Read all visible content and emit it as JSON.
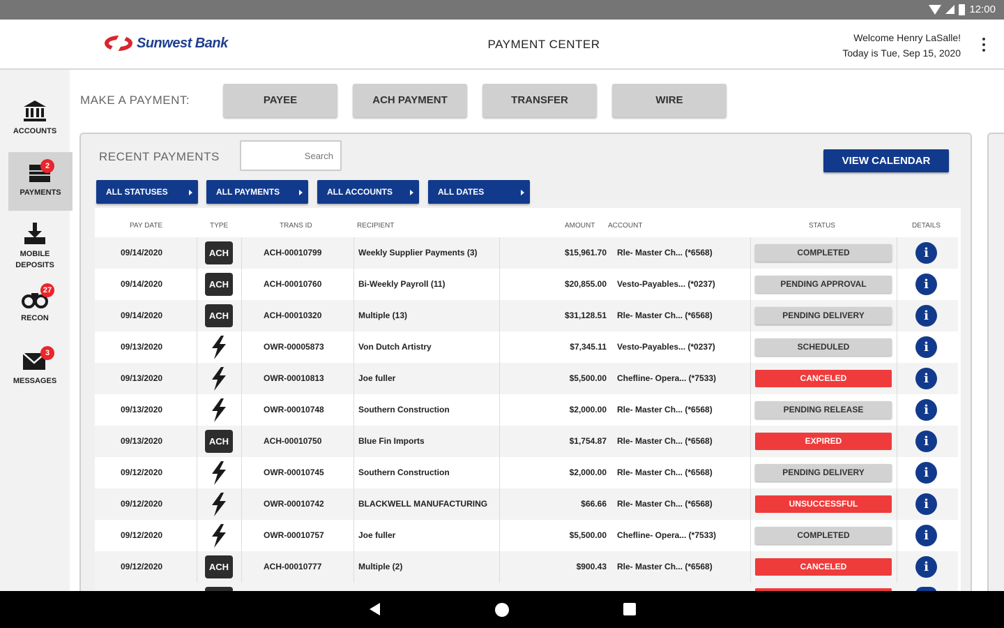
{
  "status_bar": {
    "time": "12:00"
  },
  "header": {
    "bank_name": "Sunwest Bank",
    "title": "PAYMENT CENTER",
    "welcome": "Welcome Henry LaSalle!",
    "today": "Today is Tue, Sep 15, 2020"
  },
  "sidebar": {
    "items": [
      {
        "label": "ACCOUNTS",
        "icon": "bank-icon",
        "badge": ""
      },
      {
        "label": "PAYMENTS",
        "icon": "payments-icon",
        "badge": "2"
      },
      {
        "label": "MOBILE DEPOSITS",
        "icon": "download-tray-icon",
        "badge": ""
      },
      {
        "label": "RECON",
        "icon": "binoculars-icon",
        "badge": "27"
      },
      {
        "label": "MESSAGES",
        "icon": "envelope-icon",
        "badge": "3"
      }
    ]
  },
  "make_payment": {
    "label": "MAKE A PAYMENT:",
    "buttons": [
      "PAYEE",
      "ACH PAYMENT",
      "TRANSFER",
      "WIRE"
    ]
  },
  "recent": {
    "label": "RECENT PAYMENTS",
    "search_placeholder": "Search",
    "view_calendar": "VIEW CALENDAR",
    "filters": [
      "ALL STATUSES",
      "ALL PAYMENTS",
      "ALL ACCOUNTS",
      "ALL DATES"
    ]
  },
  "table": {
    "headers": [
      "PAY DATE",
      "TYPE",
      "TRANS ID",
      "RECIPIENT",
      "AMOUNT",
      "ACCOUNT",
      "STATUS",
      "DETAILS"
    ],
    "rows": [
      {
        "date": "09/14/2020",
        "type": "ACH",
        "id": "ACH-00010799",
        "recipient": "Weekly Supplier Payments (3)",
        "amount": "$15,961.70",
        "account": "Rle- Master Ch...  (*6568)",
        "status": "COMPLETED",
        "status_color": "gray"
      },
      {
        "date": "09/14/2020",
        "type": "ACH",
        "id": "ACH-00010760",
        "recipient": "Bi-Weekly Payroll (11)",
        "amount": "$20,855.00",
        "account": "Vesto-Payables...  (*0237)",
        "status": "PENDING APPROVAL",
        "status_color": "gray"
      },
      {
        "date": "09/14/2020",
        "type": "ACH",
        "id": "ACH-00010320",
        "recipient": "Multiple (13)",
        "amount": "$31,128.51",
        "account": "Rle- Master Ch...  (*6568)",
        "status": "PENDING DELIVERY",
        "status_color": "gray"
      },
      {
        "date": "09/13/2020",
        "type": "WIRE",
        "id": "OWR-00005873",
        "recipient": "Von Dutch Artistry",
        "amount": "$7,345.11",
        "account": "Vesto-Payables...  (*0237)",
        "status": "SCHEDULED",
        "status_color": "gray"
      },
      {
        "date": "09/13/2020",
        "type": "WIRE",
        "id": "OWR-00010813",
        "recipient": "Joe fuller",
        "amount": "$5,500.00",
        "account": "Chefline- Opera...  (*7533)",
        "status": "CANCELED",
        "status_color": "red"
      },
      {
        "date": "09/13/2020",
        "type": "WIRE",
        "id": "OWR-00010748",
        "recipient": "Southern Construction",
        "amount": "$2,000.00",
        "account": "Rle- Master Ch...  (*6568)",
        "status": "PENDING RELEASE",
        "status_color": "gray"
      },
      {
        "date": "09/13/2020",
        "type": "ACH",
        "id": "ACH-00010750",
        "recipient": "Blue Fin Imports",
        "amount": "$1,754.87",
        "account": "Rle- Master Ch...  (*6568)",
        "status": "EXPIRED",
        "status_color": "red"
      },
      {
        "date": "09/12/2020",
        "type": "WIRE",
        "id": "OWR-00010745",
        "recipient": "Southern Construction",
        "amount": "$2,000.00",
        "account": "Rle- Master Ch...  (*6568)",
        "status": "PENDING DELIVERY",
        "status_color": "gray"
      },
      {
        "date": "09/12/2020",
        "type": "WIRE",
        "id": "OWR-00010742",
        "recipient": "BLACKWELL MANUFACTURING",
        "amount": "$66.66",
        "account": "Rle- Master Ch...  (*6568)",
        "status": "UNSUCCESSFUL",
        "status_color": "red"
      },
      {
        "date": "09/12/2020",
        "type": "WIRE",
        "id": "OWR-00010757",
        "recipient": "Joe fuller",
        "amount": "$5,500.00",
        "account": "Chefline- Opera...  (*7533)",
        "status": "COMPLETED",
        "status_color": "gray"
      },
      {
        "date": "09/12/2020",
        "type": "ACH",
        "id": "ACH-00010777",
        "recipient": "Multiple (2)",
        "amount": "$900.43",
        "account": "Rle- Master Ch...  (*6568)",
        "status": "CANCELED",
        "status_color": "red"
      }
    ]
  },
  "colors": {
    "brand_blue": "#123a8c",
    "brand_red": "#d7262e",
    "status_red": "#ef3b3b",
    "status_gray": "#d2d2d2"
  }
}
